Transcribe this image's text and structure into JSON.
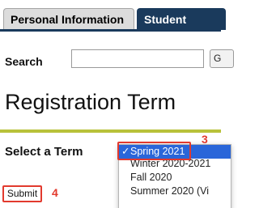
{
  "tabs": [
    {
      "label": "Personal Information",
      "active": false
    },
    {
      "label": "Student",
      "active": true
    }
  ],
  "search": {
    "label": "Search",
    "value": "",
    "placeholder": "",
    "go_label": "G"
  },
  "page_title": "Registration Term",
  "term_select": {
    "label": "Select a Term",
    "selected": "Spring 2021",
    "check": "✓",
    "options": [
      "Spring 2021",
      "Winter 2020-2021",
      "Fall 2020",
      "Summer 2020 (Vi"
    ]
  },
  "submit_label": "Submit",
  "annotations": {
    "dropdown_step": "3",
    "submit_step": "4"
  },
  "colors": {
    "tab_active": "#1a3a5c",
    "accent_rule": "#b8c23a",
    "selected_option": "#2a66d9",
    "annotation": "#e23a2e"
  }
}
